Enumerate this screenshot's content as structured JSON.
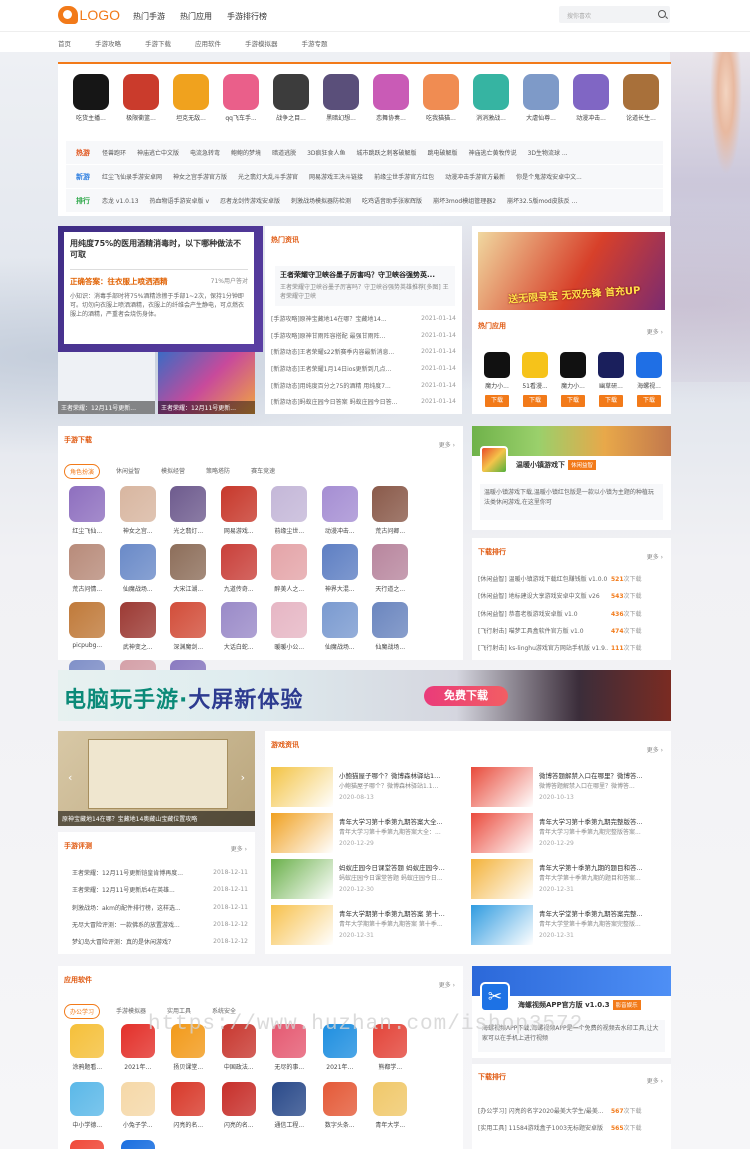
{
  "header": {
    "logo": "LOGO",
    "nav": [
      "热门手游",
      "热门应用",
      "手游排行榜"
    ],
    "search_placeholder": "搜你喜欢"
  },
  "subnav": [
    "首页",
    "手游攻略",
    "手游下载",
    "应用软件",
    "手游模拟器",
    "手游专题"
  ],
  "top_apps": [
    {
      "name": "吃货主播...",
      "color": "#161616"
    },
    {
      "name": "极限衝篮...",
      "color": "#ca3b2c"
    },
    {
      "name": "坦克无敌...",
      "color": "#f0a21e"
    },
    {
      "name": "qq飞车手...",
      "color": "#ea5f8a"
    },
    {
      "name": "战争之目...",
      "color": "#3c3c3c"
    },
    {
      "name": "黑暗幻想...",
      "color": "#5a4f7a"
    },
    {
      "name": "恋舞协奏...",
      "color": "#c95bb6"
    },
    {
      "name": "吃我猫猫...",
      "color": "#f08c52"
    },
    {
      "name": "消消激战...",
      "color": "#36b4a2"
    },
    {
      "name": "大虐仙尊...",
      "color": "#7e9ac8"
    },
    {
      "name": "动漫冲击...",
      "color": "#8066c4"
    },
    {
      "name": "论道长生...",
      "color": "#a8703a"
    }
  ],
  "tag_rows": [
    {
      "label": "热游",
      "color": "#e0531a",
      "items": [
        "怪兽跑环",
        "神庙逃亡中文版",
        "电流急转弯",
        "鲍鲍的梦境",
        "暗道逃脱",
        "3D疯狂食人鱼",
        "城市跳跃之刺客破解版",
        "跳电破解版",
        "神庙逃亡黄牧传说",
        "3D生物流球 ..."
      ]
    },
    {
      "label": "新游",
      "color": "#2f7fe0",
      "items": [
        "红尘飞仙录手游安卓网",
        "神女之宫手游官方版",
        "光之翡灯大乱斗手游官",
        "网易游戏王决斗链接",
        "前缘尘世手游官方红包",
        "动漫冲击手游官方最新",
        "你是个鬼游戏安卓中文..."
      ]
    },
    {
      "label": "排行",
      "color": "#2fa84a",
      "items": [
        "恋龙 v1.0.13",
        "热血物语手游安卓版 v",
        "忍者龙剑传游戏安卓版",
        "刺激战场模拟器防检测",
        "吃鸡语音助手张家辉版",
        "崩坏3mod模组管理器2",
        "崩坏32.5版mod皮肤反 ..."
      ]
    }
  ],
  "hero": {
    "question": "用纯度75%的医用酒精消毒时，以下哪种做法不可取",
    "answer": "正确答案：往衣服上喷洒酒精",
    "rate": "71%用户答对",
    "tip": "小知识：消毒手部时将75%酒精涂擦于手部1~2次，保持1分钟即可。切勿向衣服上喷洒酒精，衣服上的纤维会产生静电，可点燃衣服上的酒精，严重者会烧伤身体。",
    "cap1": "王者荣耀：12月11号更新...",
    "cap2": "王者荣耀：12月11号更新..."
  },
  "hot_news": {
    "title": "热门资讯",
    "lead_title": "王者荣耀守卫峡谷墨子厉害吗？守卫峡谷强势英...",
    "lead_desc": "王者荣耀守卫峡谷墨子厉害吗？守卫峡谷强势英雄推荐[多图] 王者荣耀守卫峡",
    "items": [
      {
        "t": "[手游攻略]原神宝藏地14在哪？宝藏地14...",
        "d": "2021-01-14"
      },
      {
        "t": "[手游攻略]原神甘雨阵容搭配 最强甘雨阵...",
        "d": "2021-01-14"
      },
      {
        "t": "[新游动态]王者荣耀s22新赛季内容最新消息...",
        "d": "2021-01-14"
      },
      {
        "t": "[新游动态]王者荣耀1月14日ios更新到几点...",
        "d": "2021-01-14"
      },
      {
        "t": "[新游动态]用纯度百分之75的酒精 用纯度7...",
        "d": "2021-01-14"
      },
      {
        "t": "[新游动态]蚂蚁庄园今日答案 蚂蚁庄园今日答...",
        "d": "2021-01-14"
      }
    ]
  },
  "banner_top": {
    "text": "送无限寻宝 无双先锋 首充UP"
  },
  "hot_apps": {
    "title": "热门应用",
    "more": "更多 ›",
    "items": [
      {
        "name": "魔力小...",
        "color": "#111",
        "btn": "下载"
      },
      {
        "name": "51看漫...",
        "color": "#f6c31a",
        "btn": "下载"
      },
      {
        "name": "魔力小...",
        "color": "#111",
        "btn": "下载"
      },
      {
        "name": "幽草研...",
        "color": "#1a1f5c",
        "btn": "下载"
      },
      {
        "name": "海螺视...",
        "color": "#1f6fe5",
        "btn": "下载"
      }
    ]
  },
  "game_download": {
    "title": "手游下载",
    "more": "更多 ›",
    "tabs": [
      "角色扮演",
      "休闲益智",
      "模拟经营",
      "策略塔防",
      "赛车竞速"
    ],
    "items": [
      {
        "n": "红尘飞仙...",
        "c": "#8e6fbf"
      },
      {
        "n": "神女之宫...",
        "c": "#d8b6a0"
      },
      {
        "n": "光之翡灯...",
        "c": "#6e5b8e"
      },
      {
        "n": "网易游戏...",
        "c": "#c7382b"
      },
      {
        "n": "前缘尘世...",
        "c": "#c4b7d8"
      },
      {
        "n": "动漫冲击...",
        "c": "#a58ed3"
      },
      {
        "n": "荒古问卿...",
        "c": "#8a5a4a"
      },
      {
        "n": "荒古问情...",
        "c": "#b88b7a"
      },
      {
        "n": "仙魔战场...",
        "c": "#6a8ac8"
      },
      {
        "n": "大宋江湖...",
        "c": "#8d6e5a"
      },
      {
        "n": "九道传奇...",
        "c": "#c9403a"
      },
      {
        "n": "醉美人之...",
        "c": "#e4a4a8"
      },
      {
        "n": "神界大混...",
        "c": "#5e7fc3"
      },
      {
        "n": "天行道之...",
        "c": "#b8869e"
      },
      {
        "n": "picpubg...",
        "c": "#c07a3a"
      },
      {
        "n": "武神变之...",
        "c": "#9c3a34"
      },
      {
        "n": "深渊魔剑...",
        "c": "#d24e3a"
      },
      {
        "n": "大话白蛇...",
        "c": "#9a8ac8"
      },
      {
        "n": "暖暖小公...",
        "c": "#e6b6c4"
      },
      {
        "n": "仙魔战场...",
        "c": "#7a9ad0"
      },
      {
        "n": "仙魔战场...",
        "c": "#6b86bf"
      },
      {
        "n": "仙魔战场...",
        "c": "#8090c8"
      },
      {
        "n": "师父不要...",
        "c": "#d4a0a8"
      },
      {
        "n": "太古妖灵...",
        "c": "#8a7ac0"
      }
    ]
  },
  "featured_game": {
    "name": "温暖小镇游戏下",
    "tag": "休闲益智",
    "desc": "温暖小镇游戏下载,温暖小镇红包版是一款以小镇为主题的种植玩法类休闲游戏,在这里你可"
  },
  "download_rank": {
    "title": "下载排行",
    "more": "更多 ›",
    "items": [
      {
        "t": "[休闲益智] 温暖小镇游戏下载红包赚钱版 v1.0.0",
        "n": "521",
        "s": "次下载"
      },
      {
        "t": "[休闲益智] 地标建设大享游戏安卓中文版 v26",
        "n": "543",
        "s": "次下载"
      },
      {
        "t": "[休闲益智] 恭喜老板游戏安卓版 v1.0",
        "n": "436",
        "s": "次下载"
      },
      {
        "t": "[飞行射击] 喵梦工具盒软件官方版 v1.0",
        "n": "474",
        "s": "次下载"
      },
      {
        "t": "[飞行射击] ks-linghu游戏官方网站手机版 v1.9...",
        "n": "111",
        "s": "次下载"
      }
    ]
  },
  "wide_banner": {
    "text_a": "电脑玩手游·",
    "text_b": "大屏新体验",
    "button": "免费下载"
  },
  "slider": {
    "caption": "原神宝藏地14在哪？宝藏地14奥藏山宝藏位置攻略"
  },
  "game_review": {
    "title": "手游评测",
    "more": "更多 ›",
    "items": [
      {
        "t": "王者荣耀：12月11号更新铠皇肯博再度...",
        "d": "2018-12-11"
      },
      {
        "t": "王者荣耀：12月11号更新后4在英雄...",
        "d": "2018-12-11"
      },
      {
        "t": "刺激战场：akm的配件排行榜，这样选...",
        "d": "2018-12-11"
      },
      {
        "t": "无尽大冒险评测：一款佛系的放置游戏...",
        "d": "2018-12-12"
      },
      {
        "t": "梦幻岛大冒险评测：真的是休闲游戏？",
        "d": "2018-12-12"
      }
    ]
  },
  "game_news": {
    "title": "游戏资讯",
    "more": "更多 ›",
    "items": [
      {
        "t": "小鲍猫屋子哪个？微博森林驿站1...",
        "s": "小鲍猫屋子哪个？微博森林驿站1.1...",
        "d": "2020-08-13",
        "c": "#f3c343"
      },
      {
        "t": "微博答题解禁入口在哪里？微博答...",
        "s": "微博答题解禁入口在哪里？微博答...",
        "d": "2020-10-13",
        "c": "#e84a3a"
      },
      {
        "t": "青年大学习第十季第九期答案大全...",
        "s": "青年大学习第十季第九期答案大全：...",
        "d": "2020-12-29",
        "c": "#f0a020"
      },
      {
        "t": "青年大学习第十季第九期完整版答...",
        "s": "青年大学习第十季第九期完整版答案...",
        "d": "2020-12-29",
        "c": "#ea4a3c"
      },
      {
        "t": "蚂蚁庄园今日课堂答题 蚂蚁庄园今...",
        "s": "蚂蚁庄园今日课堂答题 蚂蚁庄园今日...",
        "d": "2020-12-30",
        "c": "#6ab04a"
      },
      {
        "t": "青年大学第十季第九期的题目和答...",
        "s": "青年大学第十季第九期的题目和答案...",
        "d": "2020-12-31",
        "c": "#f3b23a"
      },
      {
        "t": "青年大学期第十季第九期答案 第十...",
        "s": "青年大学期第十季第九期答案 第十季...",
        "d": "2020-12-31",
        "c": "#f7c04a"
      },
      {
        "t": "青年大学堂第十季第九期答案完整...",
        "s": "青年大学堂第十季第九期答案完整版...",
        "d": "2020-12-31",
        "c": "#2f9be0"
      }
    ]
  },
  "apps": {
    "title": "应用软件",
    "more": "更多 ›",
    "tabs": [
      "办公学习",
      "手游模拟器",
      "实用工具",
      "系统安全"
    ],
    "items": [
      {
        "n": "涂鸦题看...",
        "c": "#f5c03a"
      },
      {
        "n": "2021年...",
        "c": "#e3302a"
      },
      {
        "n": "扬贝课堂...",
        "c": "#f29a1a"
      },
      {
        "n": "中国政法...",
        "c": "#c83830"
      },
      {
        "n": "无尽的事...",
        "c": "#e55a72"
      },
      {
        "n": "2021年...",
        "c": "#1f8fe0"
      },
      {
        "n": "熊都学...",
        "c": "#e3453a"
      },
      {
        "n": "中小学德...",
        "c": "#5bb8e8"
      },
      {
        "n": "小兔子学...",
        "c": "#f5d8a8"
      },
      {
        "n": "闪亮的名...",
        "c": "#d8392a"
      },
      {
        "n": "闪亮的名...",
        "c": "#c72f2a"
      },
      {
        "n": "通信工程...",
        "c": "#2a4a8a"
      },
      {
        "n": "数字头条...",
        "c": "#e45a38"
      },
      {
        "n": "青年大学...",
        "c": "#f0c86a"
      },
      {
        "n": "2021年...",
        "c": "#f04a3a"
      },
      {
        "n": "丽升个人...",
        "c": "#1a6fe0"
      }
    ]
  },
  "featured_app": {
    "name": "海螺视频APP官方版 v1.0.3",
    "tag": "影音娱乐",
    "desc": "海螺视频APP下载,海螺视频APP是一个免费的视频去水印工具,让大家可以在手机上进行视频"
  },
  "app_rank": {
    "title": "下载排行",
    "more": "更多 ›",
    "items": [
      {
        "t": "[办公学习] 闪亮的名字2020最美大学生/最美...",
        "n": "567",
        "s": "次下载"
      },
      {
        "t": "[实用工具] 11584游戏盒子1003无标题安卓版",
        "n": "565",
        "s": "次下载"
      }
    ]
  },
  "watermark": "https://www.huzhan.com/ishop3572"
}
